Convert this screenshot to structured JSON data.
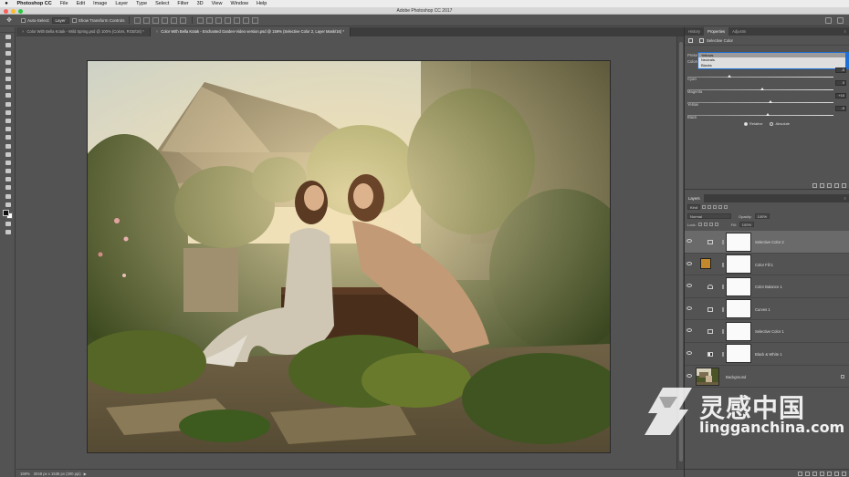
{
  "colors": {
    "ui_bg": "#535353",
    "panel_dark": "#3c3c3c",
    "accent_blue": "#1e6fd6",
    "fill_swatch": "#c2882c"
  },
  "menubar": {
    "apple": "",
    "app": "Photoshop CC",
    "items": [
      "File",
      "Edit",
      "Image",
      "Layer",
      "Type",
      "Select",
      "Filter",
      "3D",
      "View",
      "Window",
      "Help"
    ]
  },
  "titlebar": {
    "title": "Adobe Photoshop CC 2017"
  },
  "options": {
    "auto_select_label": "Auto-Select:",
    "auto_select_value": "Layer",
    "transform_label": "Show Transform Controls"
  },
  "tabs": [
    {
      "label": "Color With Bella Kotak - Wild Spring.psd @ 100% (Colors, RGB/16) *"
    },
    {
      "label": "Color With Bella Kotak - Enchanted Garden-Video version.psd @ 159% (Selective Color 2, Layer Mask/16) *"
    }
  ],
  "status": {
    "zoom": "159%",
    "doc": "2048 px x 1536 px (300 ppi)"
  },
  "panel_top": {
    "tabs": [
      "History",
      "Properties",
      "Adjustm"
    ],
    "active": 1
  },
  "properties": {
    "title": "Selective Color",
    "preset_label": "Preset:",
    "colors_label": "Colors:",
    "dropdown_options": [
      "Yellows",
      "Neutrals",
      "Blacks"
    ],
    "dropdown_selected": 0,
    "sliders": [
      {
        "label": "Cyan",
        "value": "-5",
        "pct": 29
      },
      {
        "label": "Magenta",
        "value": "0",
        "pct": 51
      },
      {
        "label": "Yellow",
        "value": "+10",
        "pct": 57
      },
      {
        "label": "Black",
        "value": "-9",
        "pct": 55
      }
    ],
    "radio_relative": "Relative",
    "radio_absolute": "Absolute"
  },
  "layers_panel": {
    "tabs": [
      "Layers"
    ],
    "kind_label": "Kind",
    "blend_mode": "Normal",
    "opacity_label": "Opacity:",
    "opacity_value": "100%",
    "lock_label": "Lock:",
    "fill_label": "Fill:",
    "fill_value": "100%",
    "layers": [
      {
        "name": "Selective Color 2",
        "type": "adjustment",
        "icon": "selective-color-icon",
        "active": true
      },
      {
        "name": "Color Fill 1",
        "type": "fill",
        "icon": "color-fill-icon",
        "active": false
      },
      {
        "name": "Color Balance 1",
        "type": "adjustment",
        "icon": "color-balance-icon",
        "active": false
      },
      {
        "name": "Curves 1",
        "type": "adjustment",
        "icon": "curves-icon",
        "active": false
      },
      {
        "name": "Selective Color 1",
        "type": "adjustment",
        "icon": "selective-color-icon",
        "active": false
      },
      {
        "name": "Black & White 1",
        "type": "adjustment",
        "icon": "black-white-icon",
        "active": false
      },
      {
        "name": "Background",
        "type": "image",
        "icon": "photo-thumb",
        "active": false
      }
    ]
  },
  "watermark": {
    "cn": "灵感中国",
    "en": "lingganchina.com"
  }
}
